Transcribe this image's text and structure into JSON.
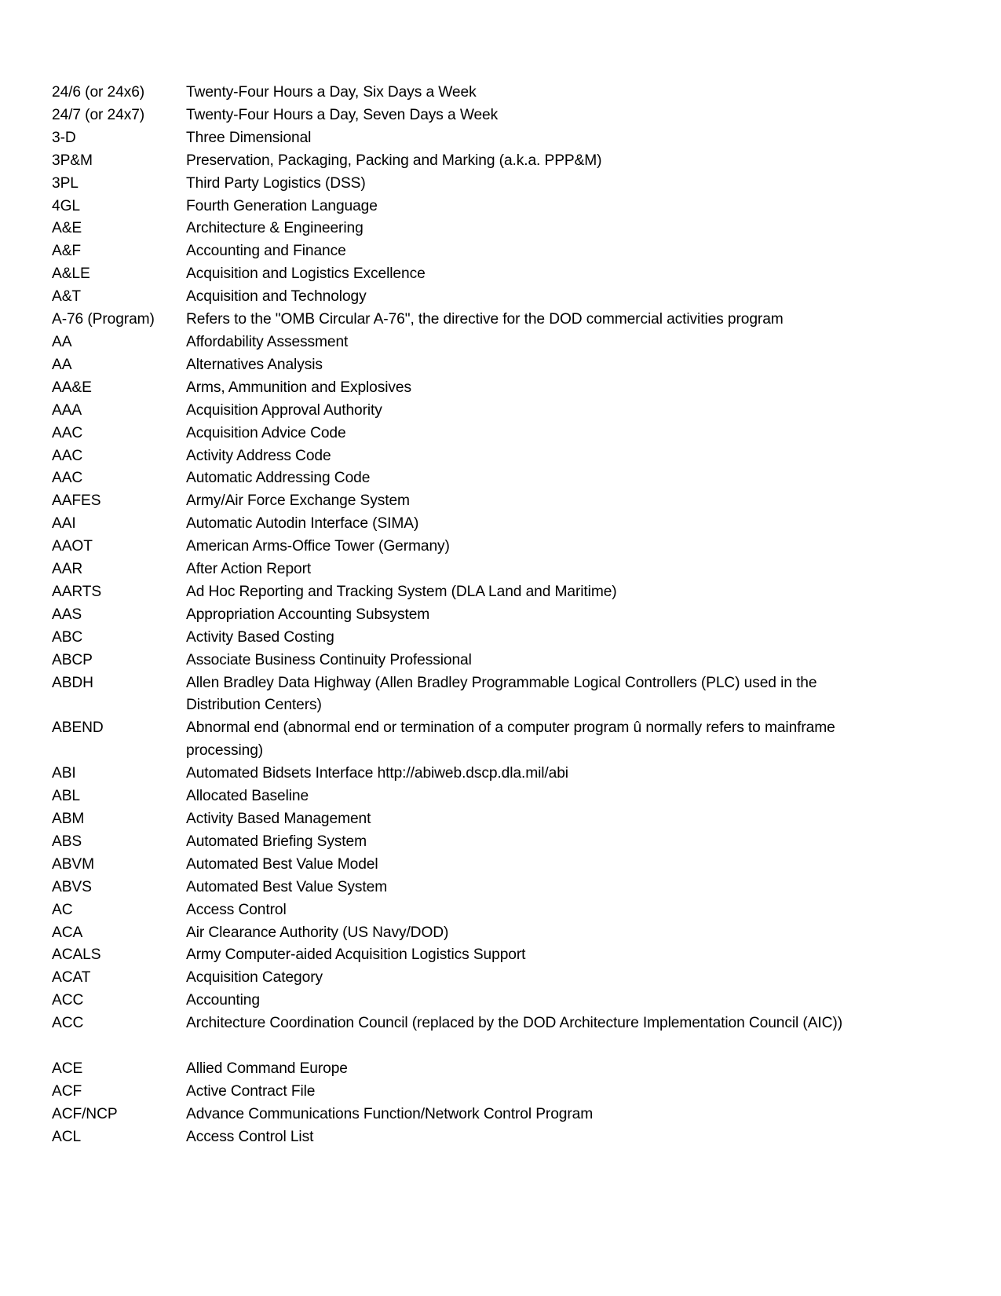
{
  "document": {
    "type": "acronym-glossary",
    "page_background": "#ffffff",
    "text_color": "#000000",
    "column_headers_visible": false
  },
  "entries": [
    {
      "term": "24/6 (or 24x6)",
      "definition": "Twenty-Four Hours a Day, Six Days a Week"
    },
    {
      "term": "24/7 (or 24x7)",
      "definition": "Twenty-Four Hours a Day, Seven Days a Week"
    },
    {
      "term": "3-D",
      "definition": "Three Dimensional"
    },
    {
      "term": "3P&M",
      "definition": "Preservation, Packaging, Packing and Marking (a.k.a. PPP&M)"
    },
    {
      "term": "3PL",
      "definition": "Third Party Logistics (DSS)"
    },
    {
      "term": "4GL",
      "definition": "Fourth Generation Language"
    },
    {
      "term": "A&E",
      "definition": "Architecture & Engineering"
    },
    {
      "term": "A&F",
      "definition": "Accounting and Finance"
    },
    {
      "term": "A&LE",
      "definition": "Acquisition and Logistics Excellence"
    },
    {
      "term": "A&T",
      "definition": "Acquisition and Technology"
    },
    {
      "term": "A-76 (Program)",
      "definition": "Refers to the \"OMB Circular A-76\", the directive for the DOD commercial activities program"
    },
    {
      "term": "AA",
      "definition": "Affordability Assessment"
    },
    {
      "term": "AA",
      "definition": "Alternatives Analysis"
    },
    {
      "term": "AA&E",
      "definition": "Arms, Ammunition and Explosives"
    },
    {
      "term": "AAA",
      "definition": "Acquisition Approval Authority"
    },
    {
      "term": "AAC",
      "definition": "Acquisition Advice Code"
    },
    {
      "term": "AAC",
      "definition": "Activity Address Code"
    },
    {
      "term": "AAC",
      "definition": "Automatic Addressing Code"
    },
    {
      "term": "AAFES",
      "definition": "Army/Air Force Exchange System"
    },
    {
      "term": "AAI",
      "definition": "Automatic Autodin Interface (SIMA)"
    },
    {
      "term": "AAOT",
      "definition": "American Arms-Office Tower (Germany)"
    },
    {
      "term": "AAR",
      "definition": "After Action Report"
    },
    {
      "term": "AARTS",
      "definition": "Ad Hoc Reporting and Tracking System (DLA Land and Maritime)"
    },
    {
      "term": "AAS",
      "definition": "Appropriation Accounting Subsystem"
    },
    {
      "term": "ABC",
      "definition": "Activity Based Costing"
    },
    {
      "term": "ABCP",
      "definition": "Associate Business Continuity Professional"
    },
    {
      "term": "ABDH",
      "definition": "Allen Bradley Data Highway (Allen Bradley Programmable Logical Controllers (PLC) used in the Distribution Centers)",
      "wraps": true
    },
    {
      "term": "ABEND",
      "definition": "Abnormal end (abnormal end or termination of a computer program û normally refers to mainframe processing)",
      "wraps": true
    },
    {
      "term": "ABI",
      "definition": "Automated Bidsets Interface http://abiweb.dscp.dla.mil/abi"
    },
    {
      "term": "ABL",
      "definition": "Allocated Baseline"
    },
    {
      "term": "ABM",
      "definition": "Activity Based Management"
    },
    {
      "term": "ABS",
      "definition": "Automated Briefing System"
    },
    {
      "term": "ABVM",
      "definition": "Automated Best Value Model"
    },
    {
      "term": "ABVS",
      "definition": "Automated Best Value System"
    },
    {
      "term": "AC",
      "definition": "Access Control"
    },
    {
      "term": "ACA",
      "definition": "Air Clearance Authority (US Navy/DOD)"
    },
    {
      "term": "ACALS",
      "definition": "Army Computer-aided Acquisition Logistics Support"
    },
    {
      "term": "ACAT",
      "definition": "Acquisition Category"
    },
    {
      "term": "ACC",
      "definition": "Accounting"
    },
    {
      "term": "ACC",
      "definition": "Architecture Coordination Council (replaced by the DOD Architecture Implementation Council (AIC))"
    },
    {
      "term": "",
      "definition": "",
      "spacer": true
    },
    {
      "term": "ACE",
      "definition": "Allied Command Europe"
    },
    {
      "term": "ACF",
      "definition": "Active Contract File"
    },
    {
      "term": "ACF/NCP",
      "definition": "Advance Communications Function/Network Control Program"
    },
    {
      "term": "ACL",
      "definition": "Access Control List"
    }
  ]
}
